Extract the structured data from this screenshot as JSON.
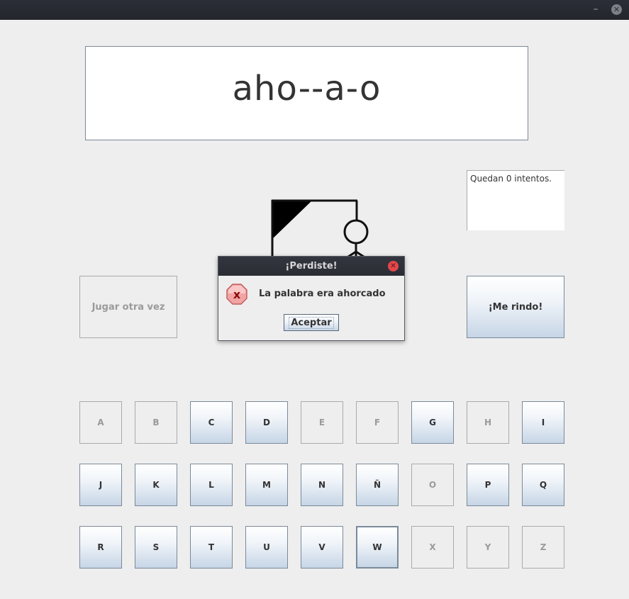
{
  "window": {
    "minimize_glyph": "–",
    "close_glyph": "✕"
  },
  "word": {
    "display": "aho--a-o"
  },
  "attempts": {
    "text": "Quedan 0 intentos."
  },
  "buttons": {
    "play_again": "Jugar otra vez",
    "give_up": "¡Me rindo!"
  },
  "keyboard": {
    "row1": [
      "A",
      "B",
      "C",
      "D",
      "E",
      "F",
      "G",
      "H",
      "I"
    ],
    "row2": [
      "J",
      "K",
      "L",
      "M",
      "N",
      "Ñ",
      "O",
      "P",
      "Q"
    ],
    "row3": [
      "R",
      "S",
      "T",
      "U",
      "V",
      "W",
      "X",
      "Y",
      "Z"
    ],
    "used_letters": [
      "A",
      "B",
      "E",
      "F",
      "H",
      "O",
      "X",
      "Y",
      "Z"
    ],
    "focused_letter": "W"
  },
  "dialog": {
    "title": "¡Perdiste!",
    "message": "La palabra era ahorcado",
    "ok_label": "Aceptar",
    "icon": "error-icon",
    "icon_glyph": "x",
    "close_glyph": "✕"
  },
  "colors": {
    "error_red": "#e2474b",
    "enabled_gradient_bottom": "#c6d5e6",
    "titlebar": "#2b2e36"
  }
}
